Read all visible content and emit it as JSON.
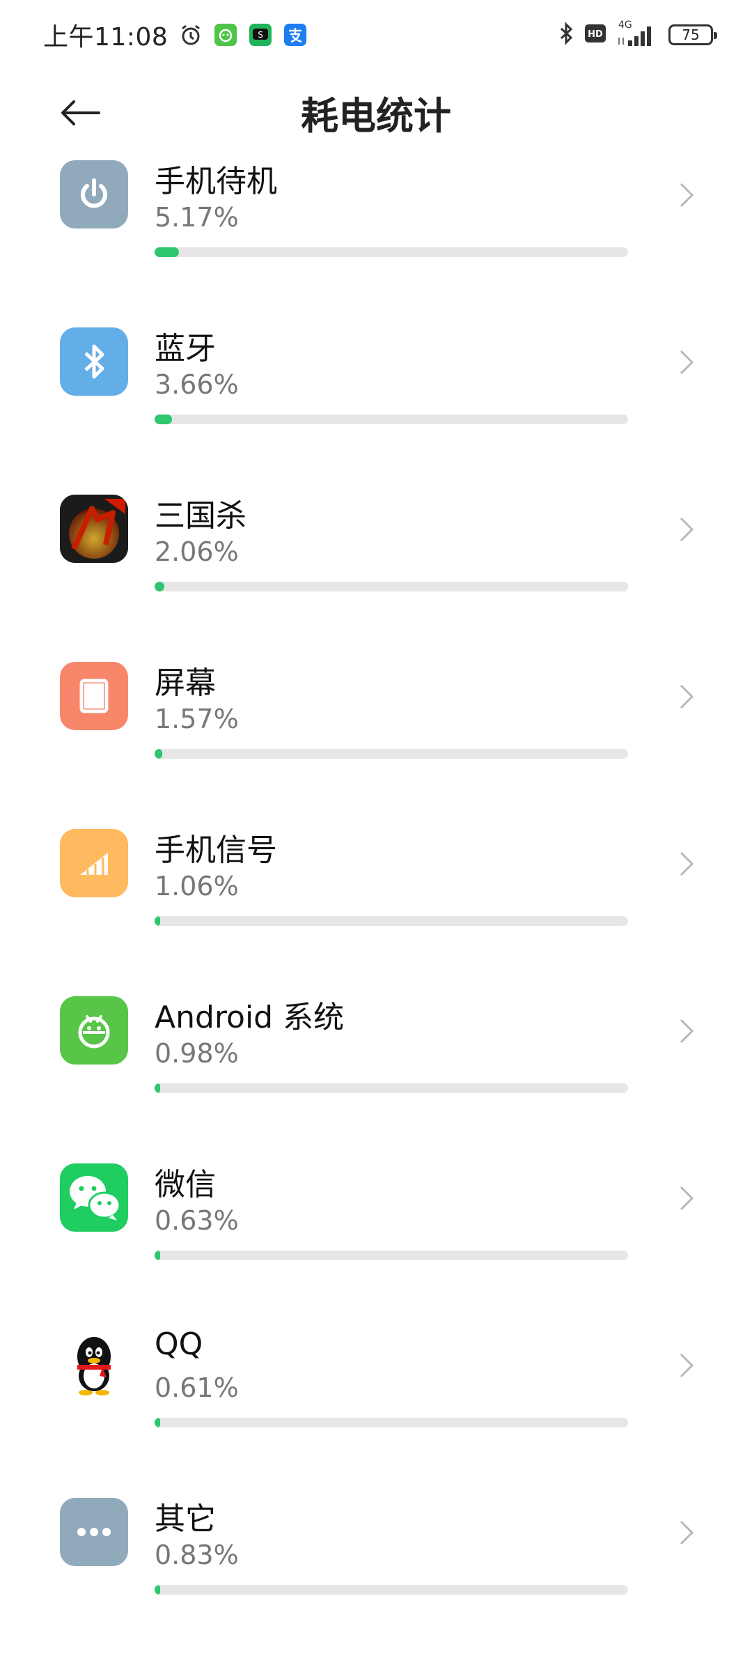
{
  "status_bar": {
    "time": "上午11:08",
    "network": "4G",
    "battery": "75"
  },
  "header": {
    "title": "耗电统计"
  },
  "items": [
    {
      "name": "手机待机",
      "percent": "5.17%",
      "value": 5.17,
      "icon": "power-icon",
      "color": "#90a9bb"
    },
    {
      "name": "蓝牙",
      "percent": "3.66%",
      "value": 3.66,
      "icon": "bluetooth-icon",
      "color": "#63aee6"
    },
    {
      "name": "三国杀",
      "percent": "2.06%",
      "value": 2.06,
      "icon": "sanguosha-app-icon",
      "color": "#1b1b1b"
    },
    {
      "name": "屏幕",
      "percent": "1.57%",
      "value": 1.57,
      "icon": "screen-icon",
      "color": "#f7866a"
    },
    {
      "name": "手机信号",
      "percent": "1.06%",
      "value": 1.06,
      "icon": "signal-icon",
      "color": "#ffb95e"
    },
    {
      "name": "Android 系统",
      "percent": "0.98%",
      "value": 0.98,
      "icon": "android-icon",
      "color": "#58c549"
    },
    {
      "name": "微信",
      "percent": "0.63%",
      "value": 0.63,
      "icon": "wechat-icon",
      "color": "#1fcd60"
    },
    {
      "name": "QQ",
      "percent": "0.61%",
      "value": 0.61,
      "icon": "qq-icon",
      "color": "#ffffff"
    },
    {
      "name": "其它",
      "percent": "0.83%",
      "value": 0.83,
      "icon": "more-icon",
      "color": "#90a9bb"
    }
  ],
  "max_value": 100
}
